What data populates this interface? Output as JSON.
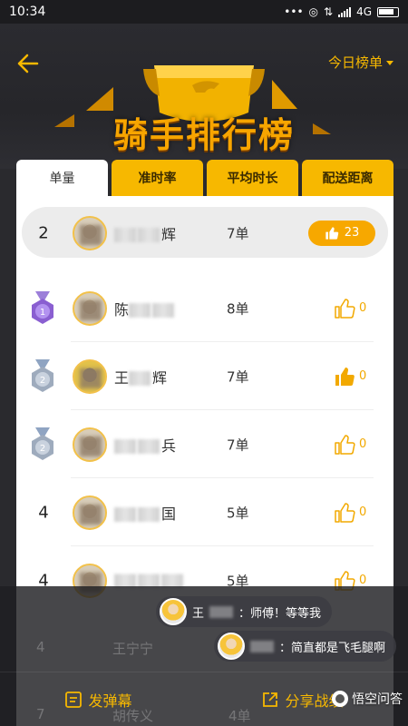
{
  "status_bar": {
    "time": "10:34",
    "network": "4G"
  },
  "header": {
    "title": "骑手排行榜",
    "ranking_select": "今日榜单"
  },
  "tabs": [
    {
      "label": "单量",
      "active": true
    },
    {
      "label": "准时率",
      "active": false
    },
    {
      "label": "平均时长",
      "active": false
    },
    {
      "label": "配送距离",
      "active": false
    }
  ],
  "my_rank": {
    "rank": "2",
    "name_tail": "辉",
    "orders": "7单",
    "likes": "23"
  },
  "rows": [
    {
      "medal": "medal-1",
      "name_head": "陈",
      "name_tail": "",
      "orders": "8单",
      "likes": "0",
      "liked": false
    },
    {
      "medal": "medal-2",
      "name_head": "王",
      "name_tail": "辉",
      "orders": "7单",
      "likes": "0",
      "liked": true
    },
    {
      "medal": "medal-2",
      "name_head": "",
      "name_tail": "兵",
      "orders": "7单",
      "likes": "0",
      "liked": false
    },
    {
      "rank": "4",
      "name_head": "",
      "name_tail": "国",
      "orders": "5单",
      "likes": "0",
      "liked": false
    },
    {
      "rank": "4",
      "name_head": "",
      "name_tail": "",
      "orders": "5单",
      "likes": "0",
      "liked": false
    }
  ],
  "ghost_rows": [
    {
      "rank": "4",
      "name": "王宁宁"
    },
    {
      "rank": "7",
      "name": "胡传义",
      "orders": "4单"
    }
  ],
  "danmu": [
    {
      "name_head": "王",
      "text": "：师傅！等等我"
    },
    {
      "name_head": "",
      "text": "：简直都是飞毛腿啊"
    }
  ],
  "bottom": {
    "send_danmu": "发弹幕",
    "share": "分享战绩"
  },
  "watermark": "悟空问答",
  "colors": {
    "accent": "#f7b800",
    "header_bg": "#2b2b30"
  }
}
